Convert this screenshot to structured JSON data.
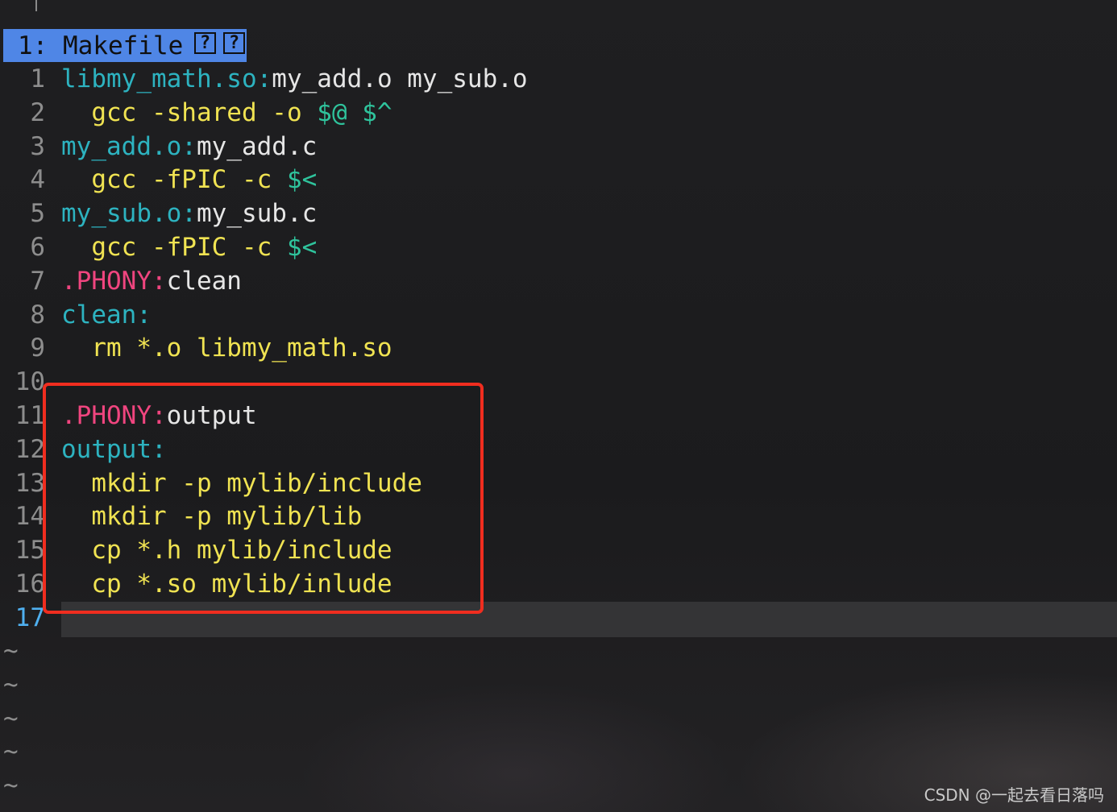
{
  "tab": {
    "label": "1: Makefile",
    "icons": [
      "?",
      "?"
    ]
  },
  "lines": [
    {
      "n": "1",
      "parts": [
        {
          "t": "libmy_math.so:",
          "c": "target"
        },
        {
          "t": "my_add.o my_sub.o",
          "c": "plain"
        }
      ]
    },
    {
      "n": "2",
      "parts": [
        {
          "t": "  gcc -shared -o ",
          "c": "cmd"
        },
        {
          "t": "$@ $^",
          "c": "auto"
        }
      ]
    },
    {
      "n": "3",
      "parts": [
        {
          "t": "my_add.o:",
          "c": "target"
        },
        {
          "t": "my_add.c",
          "c": "plain"
        }
      ]
    },
    {
      "n": "4",
      "parts": [
        {
          "t": "  gcc -fPIC -c ",
          "c": "cmd"
        },
        {
          "t": "$<",
          "c": "auto"
        }
      ]
    },
    {
      "n": "5",
      "parts": [
        {
          "t": "my_sub.o:",
          "c": "target"
        },
        {
          "t": "my_sub.c",
          "c": "plain"
        }
      ]
    },
    {
      "n": "6",
      "parts": [
        {
          "t": "  gcc -fPIC -c ",
          "c": "cmd"
        },
        {
          "t": "$<",
          "c": "auto"
        }
      ]
    },
    {
      "n": "7",
      "parts": [
        {
          "t": ".PHONY:",
          "c": "phony"
        },
        {
          "t": "clean",
          "c": "plain"
        }
      ]
    },
    {
      "n": "8",
      "parts": [
        {
          "t": "clean:",
          "c": "target"
        }
      ]
    },
    {
      "n": "9",
      "parts": [
        {
          "t": "  rm *.o libmy_math.so",
          "c": "cmd"
        }
      ]
    },
    {
      "n": "10",
      "parts": []
    },
    {
      "n": "11",
      "parts": [
        {
          "t": ".PHONY:",
          "c": "phony"
        },
        {
          "t": "output",
          "c": "plain"
        }
      ]
    },
    {
      "n": "12",
      "parts": [
        {
          "t": "output:",
          "c": "target"
        }
      ]
    },
    {
      "n": "13",
      "parts": [
        {
          "t": "  mkdir -p mylib/include",
          "c": "cmd"
        }
      ]
    },
    {
      "n": "14",
      "parts": [
        {
          "t": "  mkdir -p mylib/lib",
          "c": "cmd"
        }
      ]
    },
    {
      "n": "15",
      "parts": [
        {
          "t": "  cp *.h mylib/include",
          "c": "cmd"
        }
      ]
    },
    {
      "n": "16",
      "parts": [
        {
          "t": "  cp *.so mylib/inlude",
          "c": "cmd"
        }
      ]
    },
    {
      "n": "17",
      "parts": [],
      "current": true
    }
  ],
  "tildes": [
    "~",
    "~",
    "~",
    "~",
    "~"
  ],
  "watermark": "CSDN @一起去看日落吗",
  "colors": {
    "tab_bg": "#4f86e6",
    "target": "#2db3c0",
    "phony": "#f0457f",
    "command": "#f0e352",
    "automatic_var": "#2fc39c",
    "plain": "#e6e6e6",
    "line_number": "#8d8d8d",
    "current_line_number": "#4fb0f0",
    "highlight_border": "#f02d1f"
  }
}
